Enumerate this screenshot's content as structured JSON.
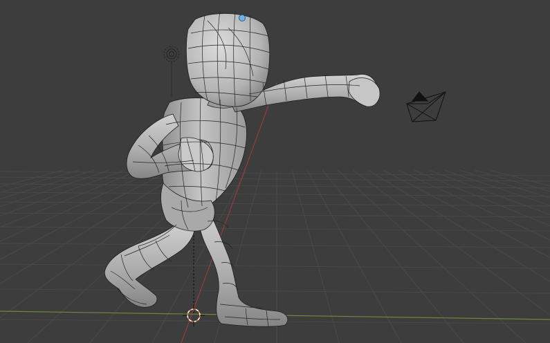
{
  "viewport": {
    "mode": "3d-viewport",
    "shading": "solid-wireframe-overlay"
  },
  "colors": {
    "background": "#3d3d3d",
    "grid_line": "#4a4a4a",
    "x_axis": "#9b3a3a",
    "y_axis": "#6f8a3a",
    "mesh_fill": "#b9b9b9",
    "mesh_shade": "#8f8f8f",
    "mesh_highlight": "#d8d8d8",
    "wire": "#1e1e1e",
    "cursor": "#e07a2f",
    "camera": "#111111",
    "light": "#222222",
    "selection_dot": "#6fb5e8"
  },
  "scene_objects": [
    {
      "name": "character-mesh",
      "icon": "mesh-icon"
    },
    {
      "name": "camera",
      "icon": "camera-icon"
    },
    {
      "name": "light",
      "icon": "light-icon"
    },
    {
      "name": "3d-cursor",
      "icon": "cursor-icon"
    }
  ]
}
